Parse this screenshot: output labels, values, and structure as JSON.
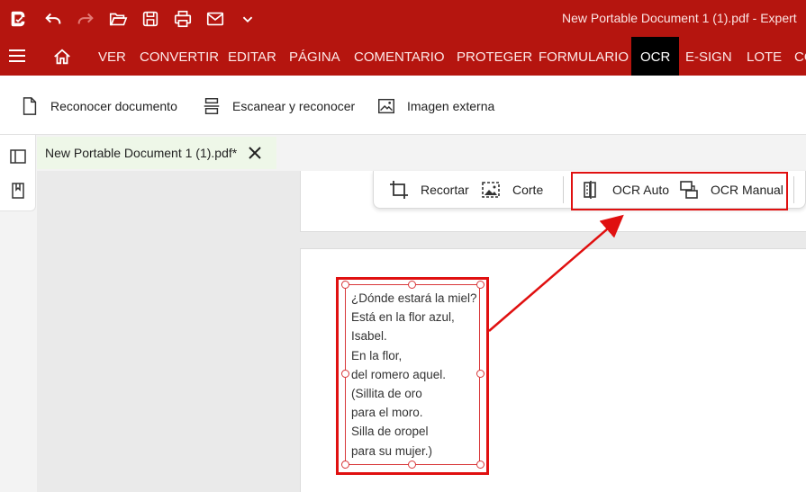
{
  "titlebar": {
    "doc_title": "New Portable Document 1 (1).pdf   -   Expert",
    "icons": [
      "app-logo-icon",
      "undo-icon",
      "redo-icon",
      "open-folder-icon",
      "save-icon",
      "print-icon",
      "mail-icon",
      "chevron-down-icon"
    ]
  },
  "menubar": {
    "items": [
      "VER",
      "CONVERTIR",
      "EDITAR",
      "PÁGINA",
      "COMENTARIO",
      "PROTEGER",
      "FORMULARIO",
      "OCR",
      "E-SIGN",
      "LOTE",
      "CO"
    ],
    "active": "OCR"
  },
  "ribbon": {
    "recognize_doc": "Reconocer documento",
    "scan_recognize": "Escanear y reconocer",
    "external_image": "Imagen externa"
  },
  "tab": {
    "label": "New Portable Document 1 (1).pdf*"
  },
  "float_toolbar": {
    "crop": "Recortar",
    "cut": "Corte",
    "ocr_auto": "OCR Auto",
    "ocr_manual": "OCR Manual"
  },
  "poem": {
    "lines": [
      "¿Dónde estará la miel?",
      "Está en la flor azul,",
      "Isabel.",
      "En la flor,",
      "del romero aquel.",
      "(Sillita de oro",
      "para el moro.",
      "Silla de oropel",
      "para su mujer.)"
    ]
  },
  "colors": {
    "brand_red": "#b5150f",
    "highlight_red": "#e01010",
    "active_tab_bg": "#000000",
    "doc_tab_bg": "#eef7e8"
  }
}
